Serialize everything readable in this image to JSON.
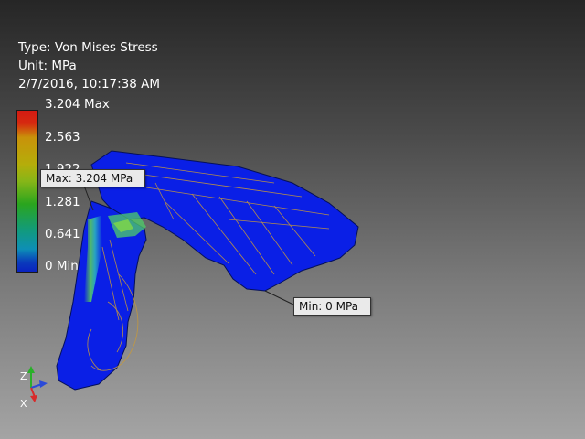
{
  "result": {
    "type_line": "Type: Von Mises Stress",
    "unit_line": "Unit: MPa",
    "date_line": "2/7/2016, 10:17:38 AM"
  },
  "legend": {
    "max_label": "3.204 Max",
    "ticks": [
      "2.563",
      "1.922",
      "1.281",
      "0.641"
    ],
    "min_label": "0 Min",
    "colors": [
      "#d41a12",
      "#c9920a",
      "#b5ad0a",
      "#2aa51e",
      "#119a80",
      "#0d8fb6",
      "#0a22c0"
    ]
  },
  "probes": {
    "max": "Max: 3.204 MPa",
    "min": "Min: 0 MPa"
  },
  "view_cube": {
    "z_label": "Z",
    "x_label": "X"
  },
  "colors": {
    "part_base": "#0a1fe6",
    "stress_high": "#7ed64a",
    "mesh_edge": "#c89a3a"
  }
}
